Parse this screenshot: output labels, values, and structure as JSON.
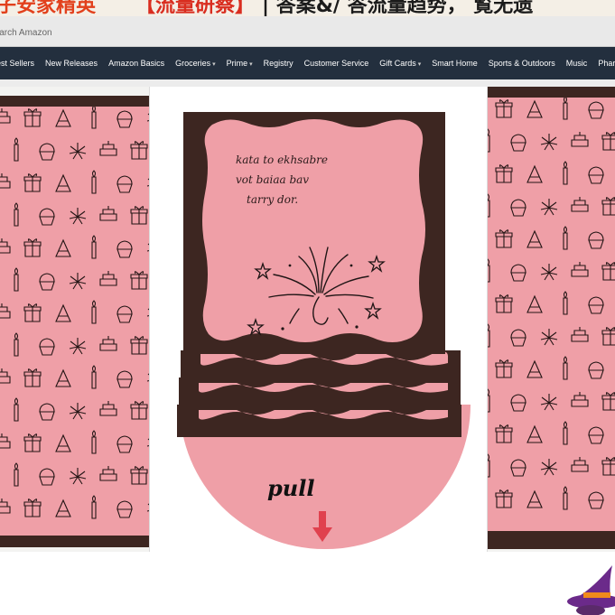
{
  "promo": {
    "part1": "子安家精英",
    "part2": "【流量研察】",
    "part3": "| 答案&/ 答流量趋势，   覧无遗"
  },
  "search": {
    "placeholder": "Search Amazon"
  },
  "nav": {
    "items": [
      {
        "label": "Best Sellers",
        "caret": false
      },
      {
        "label": "New Releases",
        "caret": false
      },
      {
        "label": "Amazon Basics",
        "caret": false
      },
      {
        "label": "Groceries",
        "caret": true
      },
      {
        "label": "Prime",
        "caret": true
      },
      {
        "label": "Registry",
        "caret": false
      },
      {
        "label": "Customer Service",
        "caret": false
      },
      {
        "label": "Gift Cards",
        "caret": true
      },
      {
        "label": "Smart Home",
        "caret": false
      },
      {
        "label": "Sports & Outdoors",
        "caret": false
      },
      {
        "label": "Music",
        "caret": false
      },
      {
        "label": "Pharmacy",
        "caret": false
      }
    ]
  },
  "product": {
    "card_lines": [
      "kata to ekhsabre",
      "vot baiaa bav",
      "tarry dor."
    ],
    "pull_label": "pull",
    "colors": {
      "pink": "#ef9fa7",
      "brown": "#3d2621",
      "arrow": "#e0414e"
    }
  },
  "icons": {
    "pattern": [
      "cake-icon",
      "gift-icon",
      "party-hat-icon",
      "candle-icon",
      "cupcake-icon",
      "firework-icon"
    ],
    "arrow": "arrow-down-icon",
    "witch": "witch-hat-icon"
  }
}
